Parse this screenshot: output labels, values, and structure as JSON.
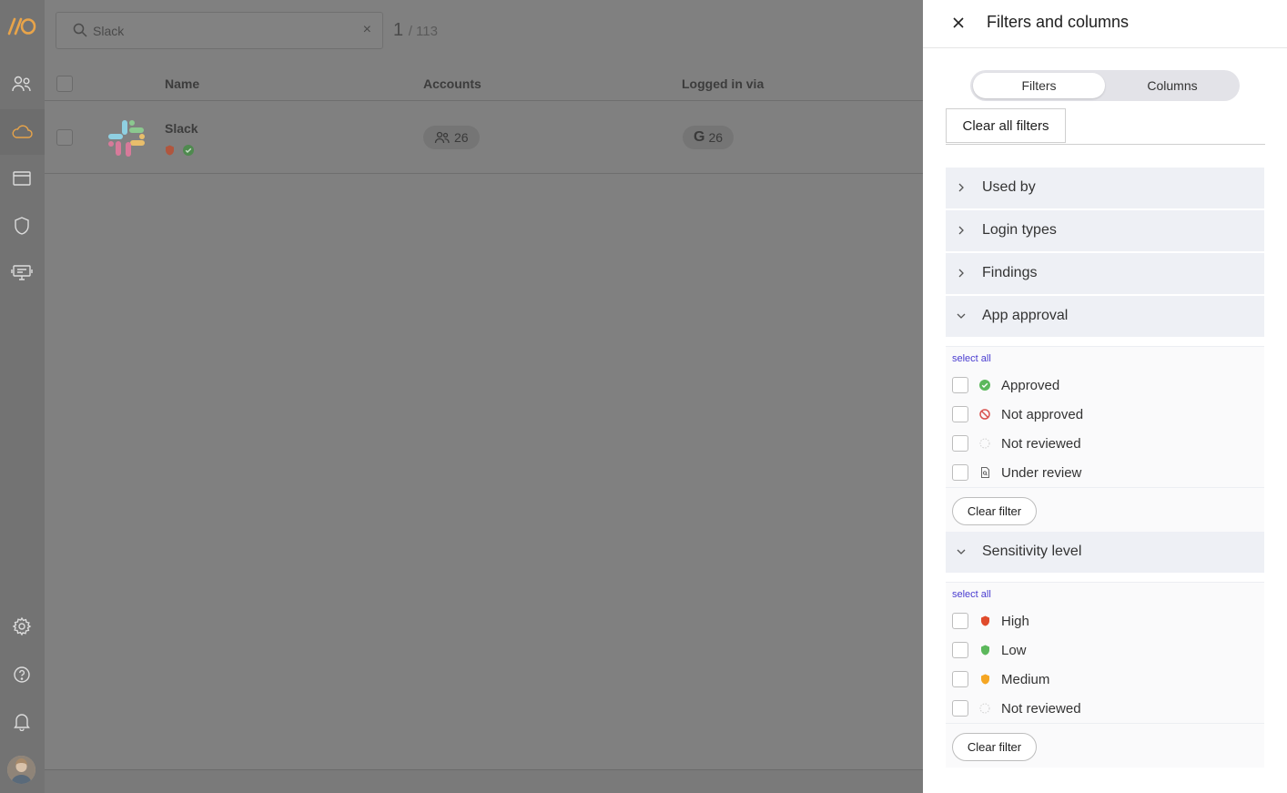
{
  "colors": {
    "accent": "#e8a44a",
    "link": "#4a3dd0",
    "approved": "#5cb85c",
    "not_approved": "#d9534f",
    "high": "#e04b2c",
    "low": "#5cb85c",
    "medium": "#f5a623"
  },
  "rail": {
    "logo": "//O",
    "icons": [
      "users-icon",
      "cloud-icon",
      "browser-icon",
      "shield-icon",
      "device-icon",
      "settings-icon",
      "help-icon",
      "bell-icon",
      "avatar"
    ]
  },
  "search": {
    "value": "Slack",
    "clear": "×"
  },
  "count": {
    "current": "1",
    "total": "/ 113"
  },
  "table": {
    "headers": {
      "name": "Name",
      "accounts": "Accounts",
      "logged_in_via": "Logged in via"
    },
    "rows": [
      {
        "name": "Slack",
        "accounts": "26",
        "login_icon": "G",
        "logged_in_via": "26"
      }
    ]
  },
  "panel": {
    "title": "Filters and columns",
    "tabs": {
      "filters": "Filters",
      "columns": "Columns"
    },
    "clear_all": "Clear all filters",
    "sections": {
      "used_by": "Used by",
      "login_types": "Login types",
      "findings": "Findings",
      "app_approval": "App approval",
      "sensitivity": "Sensitivity level"
    },
    "approval": {
      "select_all": "select all",
      "options": [
        "Approved",
        "Not approved",
        "Not reviewed",
        "Under review"
      ],
      "clear": "Clear filter"
    },
    "sensitivity_opts": {
      "select_all": "select all",
      "options": [
        "High",
        "Low",
        "Medium",
        "Not reviewed"
      ],
      "clear": "Clear filter"
    }
  }
}
